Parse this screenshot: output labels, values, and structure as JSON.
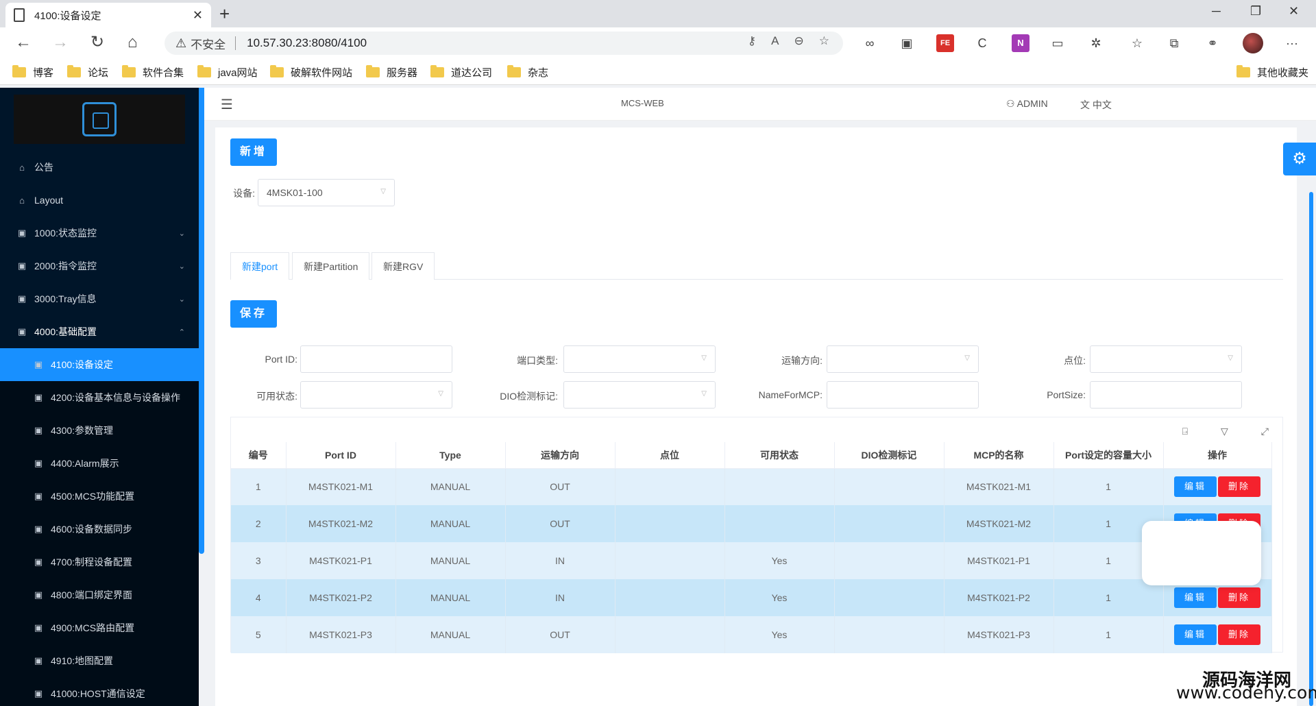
{
  "browser": {
    "tab_title": "4100:设备设定",
    "tab_close": "✕",
    "new_tab": "+",
    "insecure_label": "不安全",
    "url": "10.57.30.23:8080/4100",
    "ext_fe": "FE",
    "ext_n": "N",
    "more": "···",
    "win_min": "─",
    "win_max": "❐",
    "win_close": "✕"
  },
  "bookmarks": [
    "博客",
    "论坛",
    "软件合集",
    "java网站",
    "破解软件网站",
    "服务器",
    "道达公司",
    "杂志"
  ],
  "bookmarks_other": "其他收藏夹",
  "header": {
    "system_name": "MCS-WEB",
    "user": "ADMIN",
    "language": "中文"
  },
  "sidebar": {
    "items": [
      {
        "label": "公告",
        "icon": "home-icon"
      },
      {
        "label": "Layout",
        "icon": "home-icon"
      },
      {
        "label": "1000:状态监控",
        "icon": "grid-icon",
        "arrow": "⌄"
      },
      {
        "label": "2000:指令监控",
        "icon": "grid-icon",
        "arrow": "⌄"
      },
      {
        "label": "3000:Tray信息",
        "icon": "grid-icon",
        "arrow": "⌄"
      },
      {
        "label": "4000:基础配置",
        "icon": "grid-icon",
        "arrow": "⌃"
      }
    ],
    "sub_items": [
      "4100:设备设定",
      "4200:设备基本信息与设备操作",
      "4300:参数管理",
      "4400:Alarm展示",
      "4500:MCS功能配置",
      "4600:设备数据同步",
      "4700:制程设备配置",
      "4800:端口绑定界面",
      "4900:MCS路由配置",
      "4910:地图配置",
      "41000:HOST通信设定"
    ]
  },
  "page": {
    "add_button": "新增",
    "device_label": "设备:",
    "device_value": "4MSK01-100",
    "tabs": [
      "新建port",
      "新建Partition",
      "新建RGV"
    ],
    "save_button": "保存",
    "form": {
      "port_id": "Port ID:",
      "port_type": "端口类型:",
      "direction": "运输方向:",
      "point": "点位:",
      "available": "可用状态:",
      "dio_flag": "DIO检测标记:",
      "name_for_mcp": "NameForMCP:",
      "port_size": "PortSize:"
    }
  },
  "table": {
    "columns": [
      "编号",
      "Port ID",
      "Type",
      "运输方向",
      "点位",
      "可用状态",
      "DIO检测标记",
      "MCP的名称",
      "Port设定的容量大小",
      "操作"
    ],
    "rows": [
      [
        "1",
        "M4STK021-M1",
        "MANUAL",
        "OUT",
        "",
        "",
        "",
        "M4STK021-M1",
        "1"
      ],
      [
        "2",
        "M4STK021-M2",
        "MANUAL",
        "OUT",
        "",
        "",
        "",
        "M4STK021-M2",
        "1"
      ],
      [
        "3",
        "M4STK021-P1",
        "MANUAL",
        "IN",
        "",
        "Yes",
        "",
        "M4STK021-P1",
        "1"
      ],
      [
        "4",
        "M4STK021-P2",
        "MANUAL",
        "IN",
        "",
        "Yes",
        "",
        "M4STK021-P2",
        "1"
      ],
      [
        "5",
        "M4STK021-P3",
        "MANUAL",
        "OUT",
        "",
        "Yes",
        "",
        "M4STK021-P3",
        "1"
      ]
    ],
    "edit_label": "编辑",
    "delete_label": "删除"
  },
  "watermark": {
    "line1": "源码海洋网",
    "line2": "www.codehy.com"
  },
  "colors": {
    "primary": "#1890ff",
    "danger": "#f5222d",
    "sidebar_bg": "#001529",
    "row_odd": "#e1f0fb",
    "row_even": "#c7e6f9"
  }
}
